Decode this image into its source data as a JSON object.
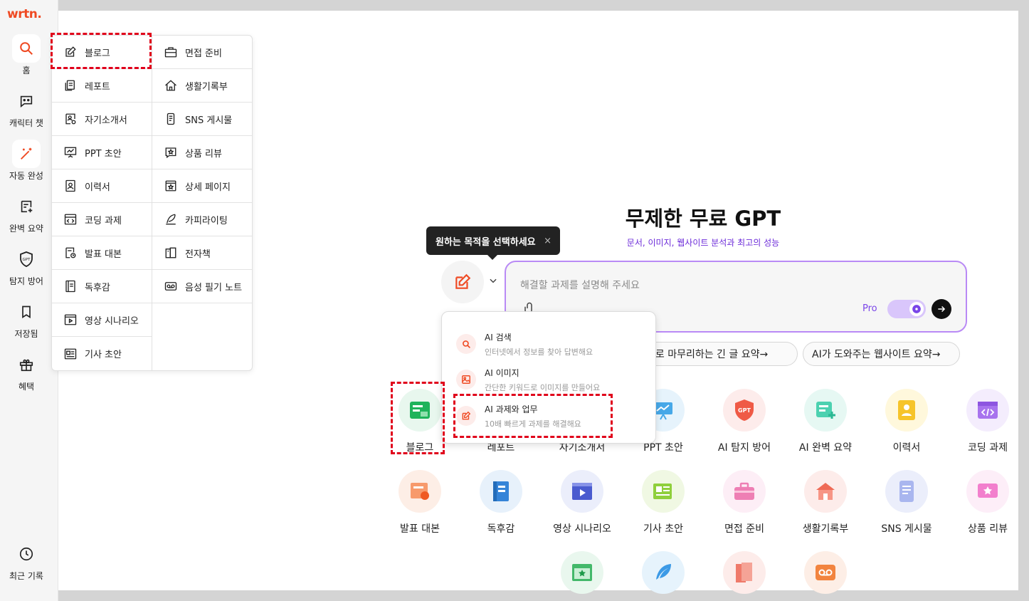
{
  "logo": "wrtn.",
  "sidebar": {
    "items": [
      {
        "label": "홈",
        "icon": "search-icon"
      },
      {
        "label": "캐릭터 챗",
        "icon": "chat-bubble-icon"
      },
      {
        "label": "자동 완성",
        "icon": "magic-wand-icon"
      },
      {
        "label": "완벽 요약",
        "icon": "summary-icon"
      },
      {
        "label": "탐지 방어",
        "icon": "gpt-shield-icon"
      },
      {
        "label": "저장됨",
        "icon": "bookmark-icon"
      },
      {
        "label": "혜택",
        "icon": "gift-icon"
      }
    ],
    "recent": {
      "label": "최근 기록",
      "icon": "clock-icon"
    }
  },
  "submenu": {
    "left": [
      "블로그",
      "레포트",
      "자기소개서",
      "PPT 초안",
      "이력서",
      "코딩 과제",
      "발표 대본",
      "독후감",
      "영상 시나리오",
      "기사 초안"
    ],
    "right": [
      "면접 준비",
      "생활기록부",
      "SNS 게시물",
      "상품 리뷰",
      "상세 페이지",
      "카피라이팅",
      "전자책",
      "음성 필기 노트"
    ]
  },
  "hero": {
    "title": "무제한 무료 GPT",
    "subtitle": "문서, 이미지, 웹사이트 분석과 최고의 성능"
  },
  "tooltip": {
    "text": "원하는 목적을 선택하세요",
    "close": "×"
  },
  "prompt": {
    "placeholder": "해결할 과제를 설명해 주세요",
    "pro_label": "Pro"
  },
  "chips": [
    "으로 마무리하는 긴 글 요약→",
    "AI가 도와주는 웹사이트 요약→"
  ],
  "dropdown": [
    {
      "title": "AI 검색",
      "desc": "인터넷에서 정보를 찾아 답변해요"
    },
    {
      "title": "AI 이미지",
      "desc": "간단한 키워드로 이미지를 만들어요"
    },
    {
      "title": "AI 과제와 업무",
      "desc": "10배 빠르게 과제를 해결해요"
    }
  ],
  "tools_row1": [
    "블로그",
    "레포트",
    "자기소개서",
    "PPT 초안",
    "AI 탐지 방어",
    "AI 완벽 요약",
    "이력서",
    "코딩 과제"
  ],
  "tools_row2": [
    "발표 대본",
    "독후감",
    "영상 시나리오",
    "기사 초안",
    "면접 준비",
    "생활기록부",
    "SNS 게시물",
    "상품 리뷰"
  ],
  "colors": {
    "brand": "#ef4a23",
    "accent_purple": "#7a45e8",
    "highlight_red": "#e0001b"
  }
}
